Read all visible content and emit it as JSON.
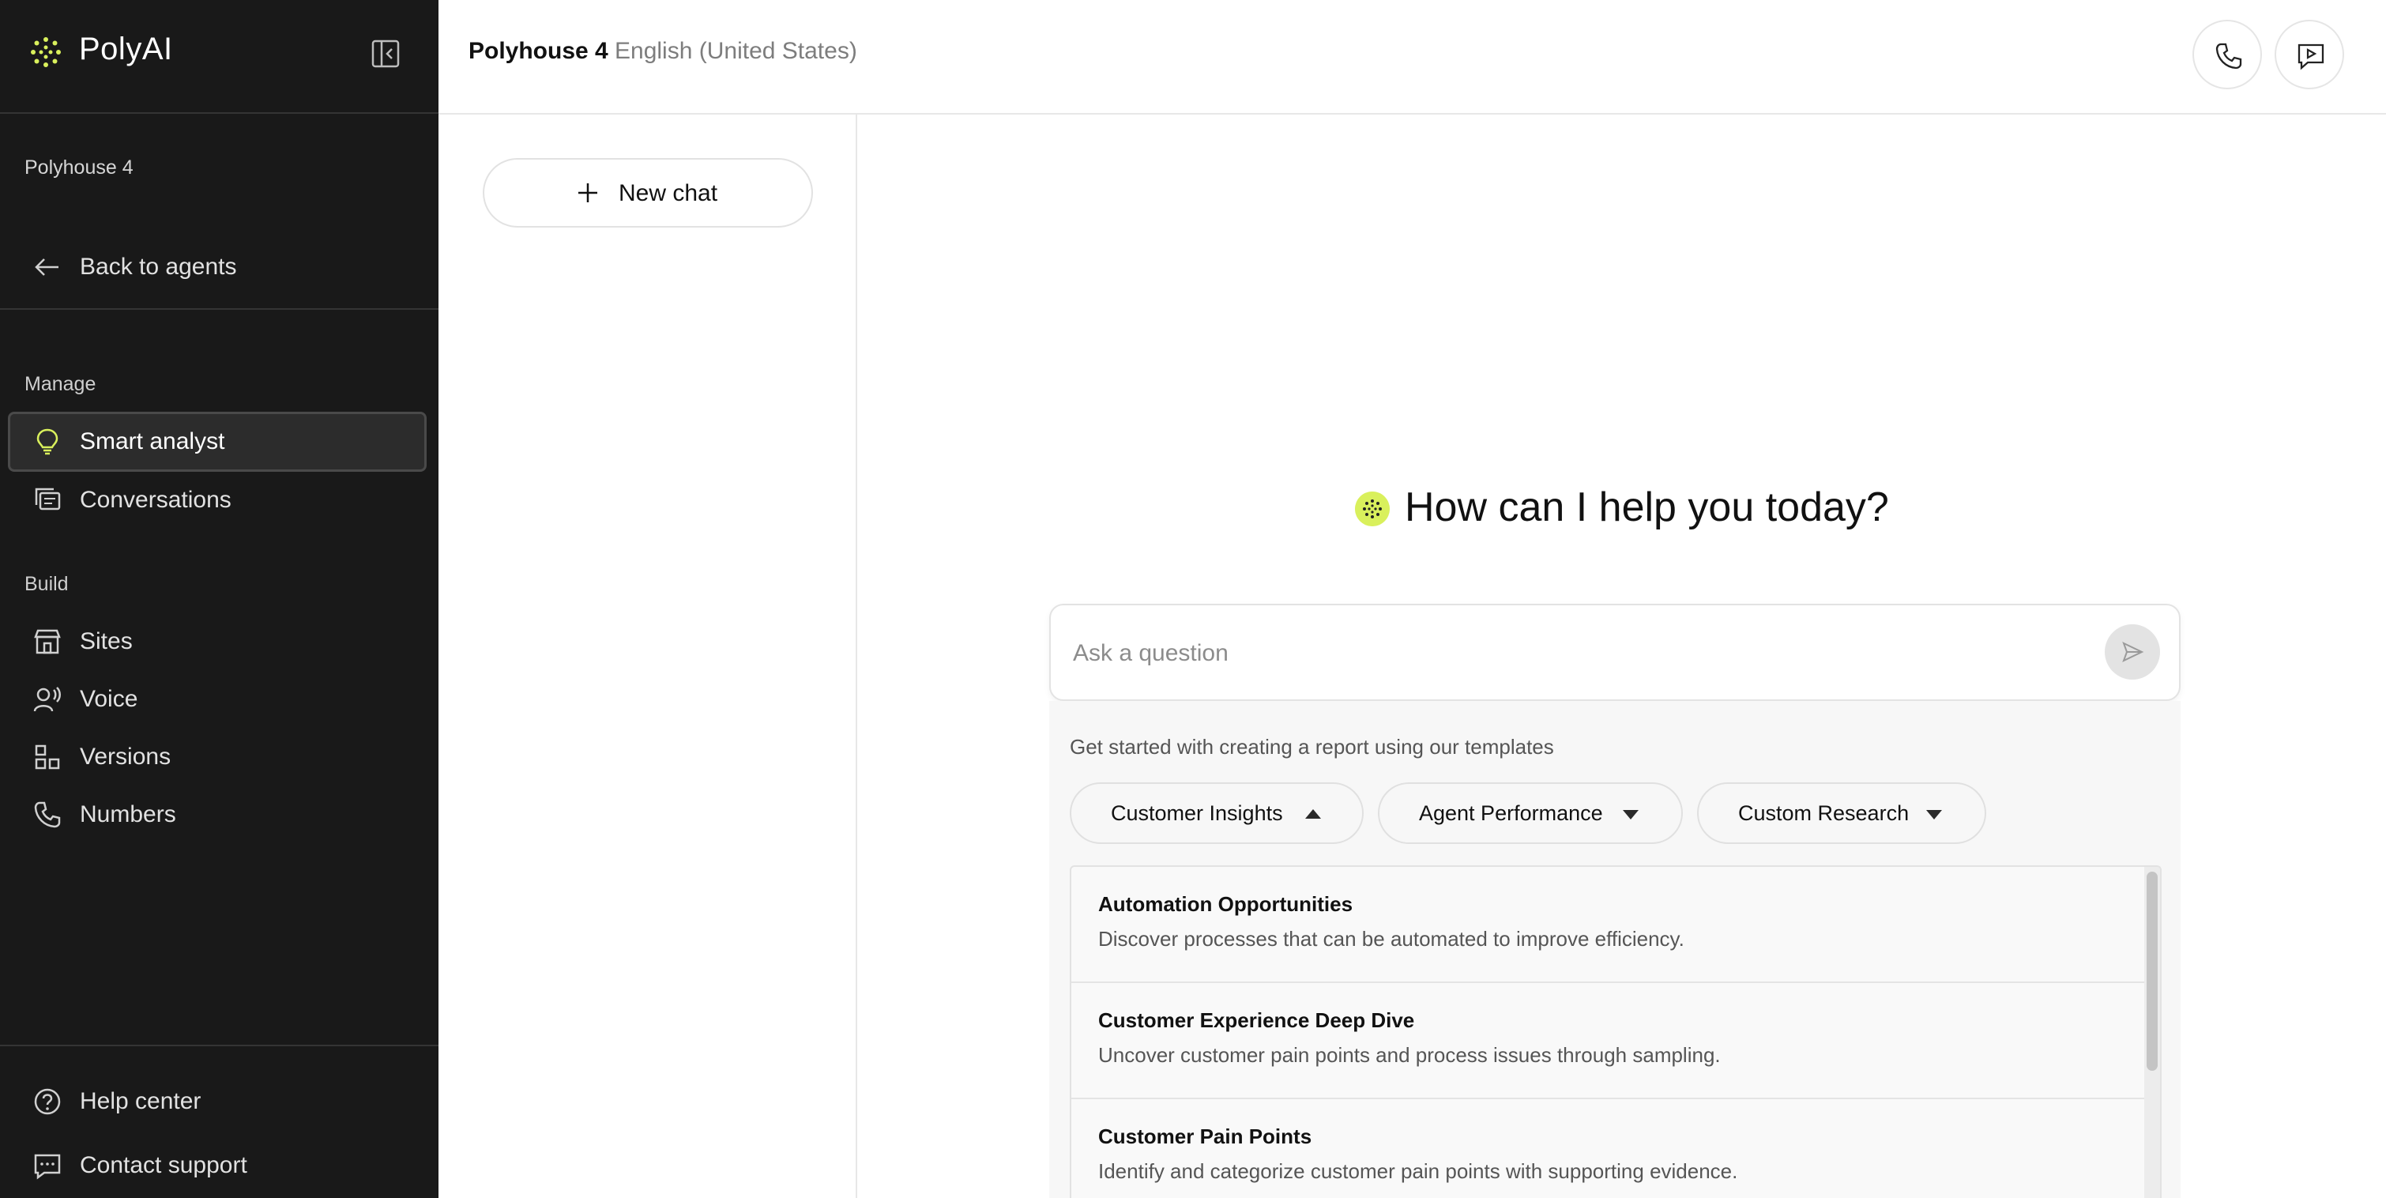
{
  "sidebar": {
    "brand": "PolyAI",
    "agent_name": "Polyhouse 4",
    "back_label": "Back to agents",
    "manage_label": "Manage",
    "build_label": "Build",
    "manage_items": [
      {
        "label": "Smart analyst",
        "icon": "lightbulb-icon",
        "active": true
      },
      {
        "label": "Conversations",
        "icon": "conversations-icon",
        "active": false
      }
    ],
    "build_items": [
      {
        "label": "Sites",
        "icon": "store-icon"
      },
      {
        "label": "Voice",
        "icon": "voice-icon"
      },
      {
        "label": "Versions",
        "icon": "versions-icon"
      },
      {
        "label": "Numbers",
        "icon": "phone-icon"
      }
    ],
    "footer_items": [
      {
        "label": "Help center",
        "icon": "help-icon"
      },
      {
        "label": "Contact support",
        "icon": "chat-support-icon"
      }
    ]
  },
  "header": {
    "agent": "Polyhouse 4",
    "language": "English (United States)"
  },
  "chat_panel": {
    "new_chat_label": "New chat"
  },
  "main": {
    "greeting": "How can I help you today?",
    "input_placeholder": "Ask a question",
    "templates_hint": "Get started with creating a report using our templates",
    "template_categories": [
      {
        "label": "Customer Insights",
        "expanded": true
      },
      {
        "label": "Agent Performance",
        "expanded": false
      },
      {
        "label": "Custom Research",
        "expanded": false
      }
    ],
    "templates": [
      {
        "title": "Automation Opportunities",
        "description": "Discover processes that can be automated to improve efficiency."
      },
      {
        "title": "Customer Experience Deep Dive",
        "description": "Uncover customer pain points and process issues through sampling."
      },
      {
        "title": "Customer Pain Points",
        "description": "Identify and categorize customer pain points with supporting evidence."
      }
    ]
  },
  "colors": {
    "sidebar_bg": "#191919",
    "accent": "#d9f05c",
    "active_item_bg": "#2c2c2c"
  }
}
